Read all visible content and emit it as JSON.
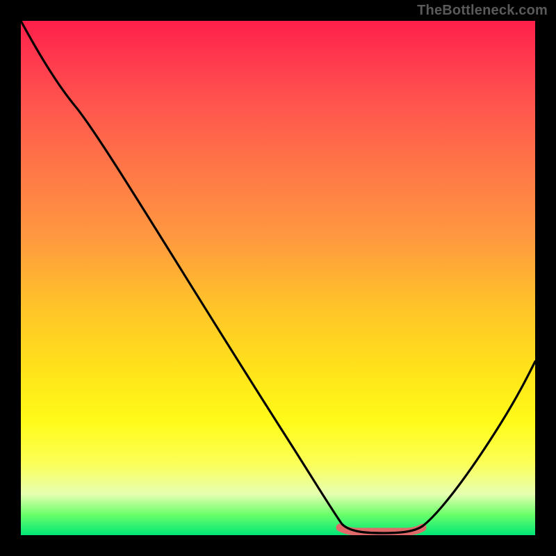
{
  "attribution": "TheBottleneck.com",
  "colors": {
    "background": "#000000",
    "gradient_top": "#ff1f4a",
    "gradient_bottom": "#00e676",
    "curve": "#000000",
    "highlight": "#e06a6a"
  },
  "chart_data": {
    "type": "line",
    "title": "",
    "xlabel": "",
    "ylabel": "",
    "xlim": [
      0,
      100
    ],
    "ylim": [
      0,
      100
    ],
    "x": [
      0,
      5,
      10,
      15,
      20,
      25,
      30,
      35,
      40,
      45,
      50,
      55,
      60,
      62,
      65,
      68,
      71,
      74,
      77,
      80,
      85,
      90,
      95,
      100
    ],
    "values": [
      100,
      92,
      85,
      78,
      70,
      63,
      55,
      47,
      40,
      32,
      24,
      16,
      8,
      4,
      1,
      0,
      0,
      0,
      1,
      3,
      10,
      20,
      30,
      40
    ],
    "highlight_range_x": [
      62,
      78
    ],
    "note": "x and y are in percent of the plot-area width/height; y measured from bottom. Curve is a single black line dipping to a flat minimum around x≈65–77%, then rising toward the right edge. A short salmon-colored thick segment sits on the flat minimum. No axes, ticks, or numeric labels are rendered; the colored gradient background spans red (top) → yellow → green (bottom)."
  }
}
